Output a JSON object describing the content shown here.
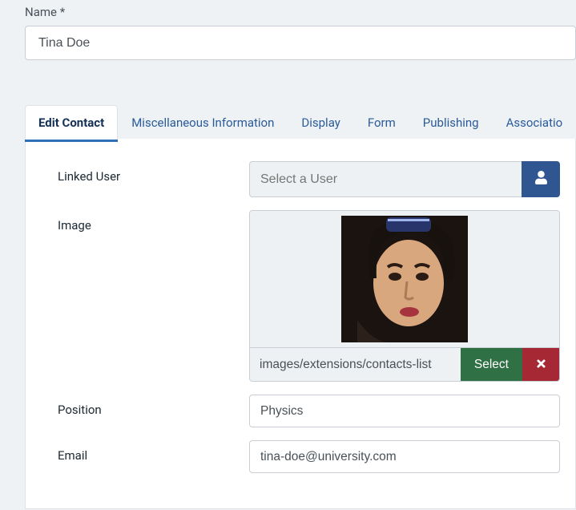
{
  "name": {
    "label": "Name *",
    "value": "Tina Doe"
  },
  "tabs": [
    {
      "label": "Edit Contact",
      "active": true
    },
    {
      "label": "Miscellaneous Information",
      "active": false
    },
    {
      "label": "Display",
      "active": false
    },
    {
      "label": "Form",
      "active": false
    },
    {
      "label": "Publishing",
      "active": false
    },
    {
      "label": "Associatio",
      "active": false
    }
  ],
  "fields": {
    "linked_user": {
      "label": "Linked User",
      "placeholder": "Select a User"
    },
    "image": {
      "label": "Image",
      "path": "images/extensions/contacts-list",
      "select_label": "Select"
    },
    "position": {
      "label": "Position",
      "value": "Physics"
    },
    "email": {
      "label": "Email",
      "value": "tina-doe@university.com"
    }
  },
  "colors": {
    "accent_blue": "#2f5691",
    "tab_underline": "#2f6fb5",
    "select_green": "#2f7044",
    "clear_red": "#a52834"
  }
}
